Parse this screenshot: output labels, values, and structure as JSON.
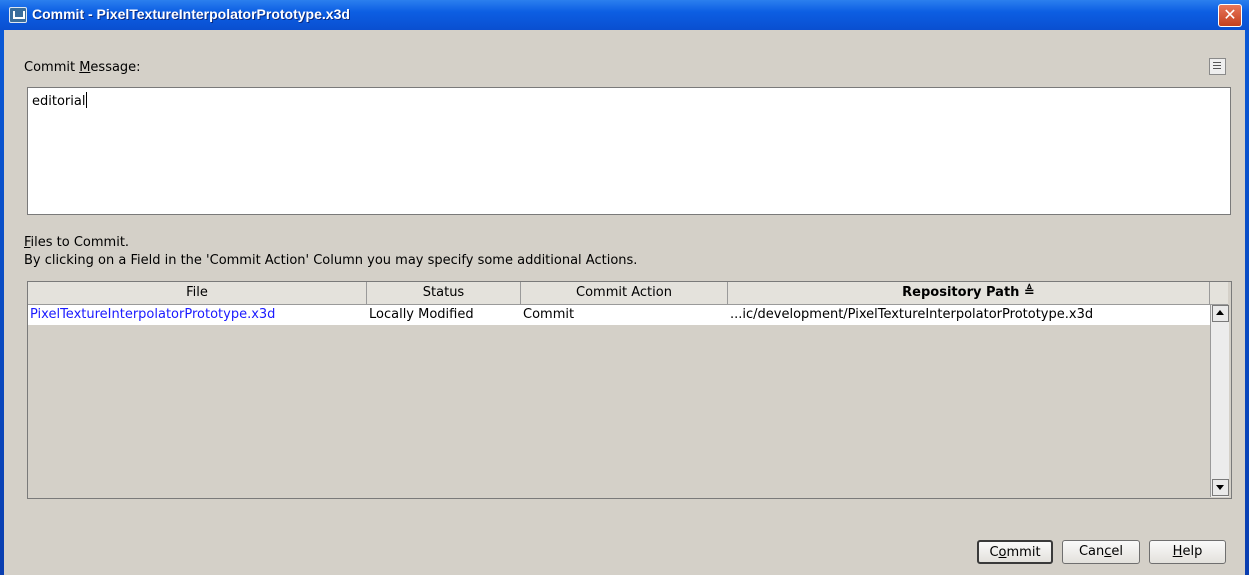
{
  "window": {
    "title": "Commit - PixelTextureInterpolatorPrototype.x3d",
    "close_glyph": "✕"
  },
  "commit_message": {
    "label_prefix": "Commit ",
    "label_mnemonic": "M",
    "label_suffix": "essage:",
    "value": "editorial"
  },
  "files": {
    "label_mnemonic": "F",
    "label_rest": "iles to Commit.",
    "hint": "By clicking on a Field in the 'Commit Action' Column you may specify some additional Actions.",
    "columns": [
      "File",
      "Status",
      "Commit Action",
      "Repository Path ≜"
    ],
    "rows": [
      {
        "file": "PixelTextureInterpolatorPrototype.x3d",
        "status": "Locally Modified",
        "action": "Commit",
        "path": "...ic/development/PixelTextureInterpolatorPrototype.x3d"
      }
    ]
  },
  "buttons": {
    "commit_pre": "C",
    "commit_mn": "o",
    "commit_post": "mmit",
    "cancel_pre": "Can",
    "cancel_mn": "c",
    "cancel_post": "el",
    "help_mn": "H",
    "help_post": "elp"
  },
  "colors": {
    "title_bar": "#0c5ee3",
    "file_link": "#1a1aff",
    "dialog_bg": "#d4d0c8"
  }
}
